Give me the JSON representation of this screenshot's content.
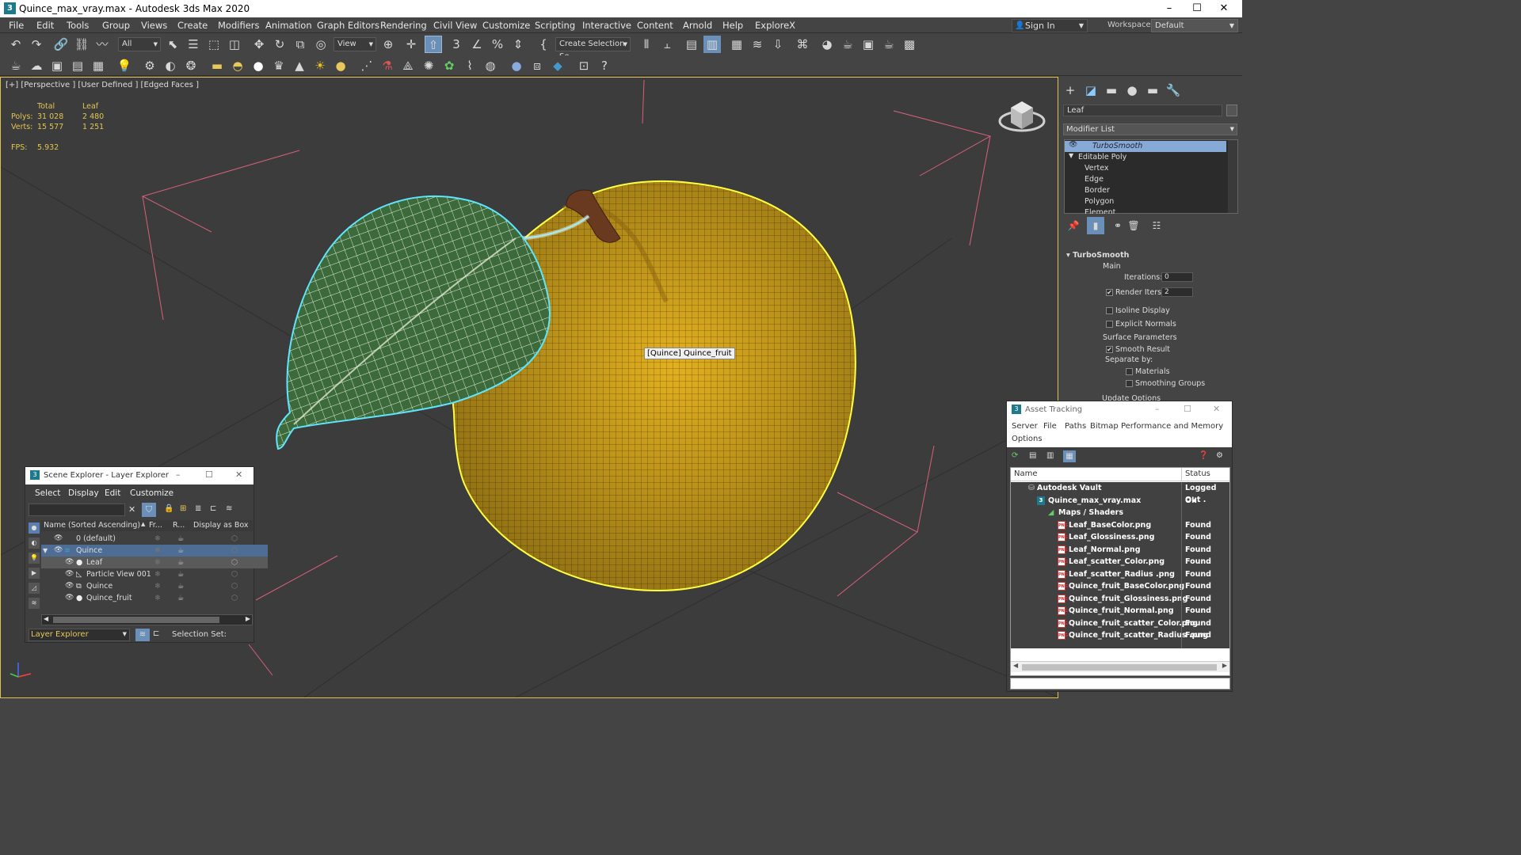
{
  "window": {
    "title": "Quince_max_vray.max - Autodesk 3ds Max 2020",
    "icon": "3ds-max-app-icon",
    "minimize": "–",
    "maximize": "☐",
    "close": "✕"
  },
  "menu": [
    "File",
    "Edit",
    "Tools",
    "Group",
    "Views",
    "Create",
    "Modifiers",
    "Animation",
    "Graph Editors",
    "Rendering",
    "Civil View",
    "Customize",
    "Scripting",
    "Interactive",
    "Content",
    "Arnold",
    "Help",
    "ExploreX"
  ],
  "signin": {
    "label": "Sign In",
    "icon": "user-icon"
  },
  "workspaces": {
    "label": "Workspaces:",
    "value": "Default"
  },
  "toolbar1": {
    "filter": "All",
    "ref_coord": "View",
    "named_sel": "Create Selection Se"
  },
  "viewport": {
    "label": "[+] [Perspective ] [User Defined ] [Edged Faces ]",
    "stats": {
      "col_total": "Total",
      "col_leaf": "Leaf",
      "polys_label": "Polys:",
      "polys_total": "31 028",
      "polys_leaf": "2 480",
      "verts_label": "Verts:",
      "verts_total": "15 577",
      "verts_leaf": "1 251",
      "fps_label": "FPS:",
      "fps_value": "5.932"
    },
    "tooltip": "[Quince] Quince_fruit",
    "colors": {
      "fruit": "#e7b21c",
      "leaf": "#3f6b3a",
      "selection": "#5fe6ff",
      "highlight": "#ffff40",
      "grid": "#d8607a"
    }
  },
  "command_panel": {
    "tabs": [
      "create-icon",
      "modify-icon",
      "hierarchy-icon",
      "motion-icon",
      "display-icon",
      "utilities-icon"
    ],
    "object_name": "Leaf",
    "modifier_list": "Modifier List",
    "stack": [
      "TurboSmooth",
      "Editable Poly",
      "Vertex",
      "Edge",
      "Border",
      "Polygon",
      "Element"
    ],
    "rollout": {
      "title": "TurboSmooth",
      "main": "Main",
      "iterations_label": "Iterations:",
      "iterations": "0",
      "render_iters_label": "Render Iters:",
      "render_iters": "2",
      "isoline": "Isoline Display",
      "explicit_normals": "Explicit Normals",
      "surface": "Surface Parameters",
      "smooth_result": "Smooth Result",
      "separate_by": "Separate by:",
      "materials": "Materials",
      "smoothing_groups": "Smoothing Groups",
      "update": "Update Options"
    }
  },
  "scene_explorer": {
    "title": "Scene Explorer - Layer Explorer",
    "menu": [
      "Select",
      "Display",
      "Edit",
      "Customize"
    ],
    "columns": [
      "Name (Sorted Ascending)",
      "Fr...",
      "R...",
      "Display as Box"
    ],
    "rows": [
      "0 (default)",
      "Quince",
      "Leaf",
      "Particle View 001",
      "Quince",
      "Quince_fruit"
    ],
    "footer_layer": "Layer Explorer",
    "footer_selset": "Selection Set:"
  },
  "asset_tracking": {
    "title": "Asset Tracking",
    "menu": [
      "Server",
      "File",
      "Paths",
      "Bitmap Performance and Memory",
      "Options"
    ],
    "columns": [
      "Name",
      "Status"
    ],
    "rows": [
      {
        "name": "Autodesk Vault",
        "status": "Logged Out ."
      },
      {
        "name": "Quince_max_vray.max",
        "status": "Ok"
      },
      {
        "name": "Maps / Shaders",
        "status": ""
      },
      {
        "name": "Leaf_BaseColor.png",
        "status": "Found"
      },
      {
        "name": "Leaf_Glossiness.png",
        "status": "Found"
      },
      {
        "name": "Leaf_Normal.png",
        "status": "Found"
      },
      {
        "name": "Leaf_scatter_Color.png",
        "status": "Found"
      },
      {
        "name": "Leaf_scatter_Radius .png",
        "status": "Found"
      },
      {
        "name": "Quince_fruit_BaseColor.png",
        "status": "Found"
      },
      {
        "name": "Quince_fruit_Glossiness.png",
        "status": "Found"
      },
      {
        "name": "Quince_fruit_Normal.png",
        "status": "Found"
      },
      {
        "name": "Quince_fruit_scatter_Color.png",
        "status": "Found"
      },
      {
        "name": "Quince_fruit_scatter_Radius .png",
        "status": "Found"
      }
    ]
  }
}
